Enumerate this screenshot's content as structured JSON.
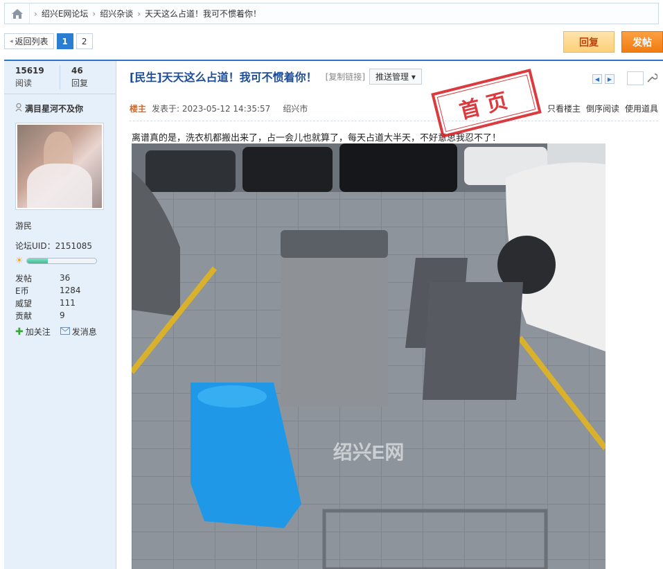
{
  "breadcrumb": {
    "home_icon": "home-icon",
    "items": [
      "绍兴E网论坛",
      "绍兴杂谈",
      "天天这么占道！我可不惯着你！"
    ]
  },
  "pager": {
    "back_label": "返回列表",
    "pages": [
      "1",
      "2"
    ],
    "current_page": "1"
  },
  "actions": {
    "reply_label": "回复",
    "post_label": "发帖"
  },
  "stats": {
    "views": "15619",
    "views_label": "阅读",
    "replies": "46",
    "replies_label": "回复"
  },
  "post": {
    "title": "[民生]天天这么占道！我可不惯着你！",
    "copy_link": "[复制链接]",
    "push_manage": "推送管理 ▾",
    "floor_label": "楼主",
    "published": "发表于: 2023-05-12 14:35:57",
    "location": "绍兴市",
    "tools": [
      "只看楼主",
      "倒序阅读",
      "使用道具"
    ],
    "stamp_text": "首页",
    "content_text": "离谱真的是，洗衣机都搬出来了，占一会儿也就算了，每天占道大半天，不好意思我忍不了！",
    "watermark": "绍兴E网"
  },
  "author": {
    "name": "满目星河不及你",
    "group": "游民",
    "uid_label": "论坛UID：2151085",
    "level_fraction": 0.3,
    "rows": [
      {
        "key": "发帖",
        "value": "36"
      },
      {
        "key": "E币",
        "value": "1284"
      },
      {
        "key": "威望",
        "value": "111"
      },
      {
        "key": "贡献",
        "value": "9"
      }
    ],
    "follow_label": "加关注",
    "message_label": "发消息"
  },
  "colors": {
    "accent": "#2b73c4",
    "title": "#1f4e99",
    "stamp": "#d8262b",
    "post_button": "#f17c12"
  }
}
